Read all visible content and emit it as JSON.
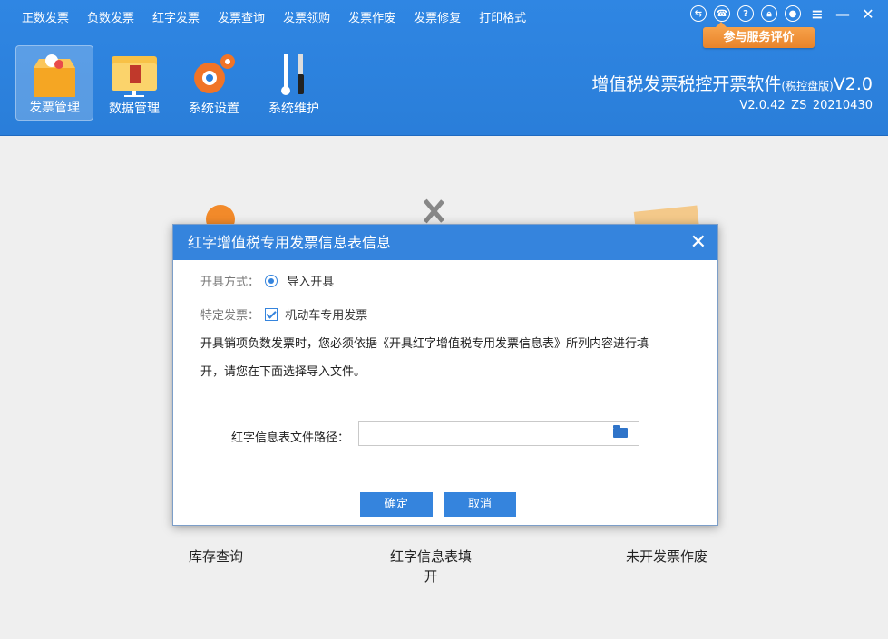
{
  "menu": [
    "正数发票",
    "负数发票",
    "红字发票",
    "发票查询",
    "发票领购",
    "发票作废",
    "发票修复",
    "打印格式"
  ],
  "top_icons": [
    "exchange-icon",
    "phone-icon",
    "help-icon",
    "lock-icon",
    "user-icon",
    "menu-icon",
    "minimize-icon",
    "close-icon"
  ],
  "feedback_label": "参与服务评价",
  "toolbar": [
    {
      "label": "发票管理",
      "active": true
    },
    {
      "label": "数据管理",
      "active": false
    },
    {
      "label": "系统设置",
      "active": false
    },
    {
      "label": "系统维护",
      "active": false
    }
  ],
  "brand": {
    "title": "增值税发票税控开票软件",
    "edition": "(税控盘版)",
    "suffix": "V2.0",
    "version": "V2.0.42_ZS_20210430"
  },
  "cards": [
    "库存查询",
    "红字信息表填开",
    "未开发票作废"
  ],
  "dialog": {
    "title": "红字增值税专用发票信息表信息",
    "method_label": "开具方式：",
    "method_value": "导入开具",
    "special_label": "特定发票：",
    "special_value": "机动车专用发票",
    "description_line1": "开具销项负数发票时，您必须依据《开具红字增值税专用发票信息表》所列内容进行填",
    "description_line2": "开，请您在下面选择导入文件。",
    "path_label": "红字信息表文件路径：",
    "path_value": "",
    "ok": "确定",
    "cancel": "取消"
  },
  "colors": {
    "header": "#2f86e3",
    "accent": "#3584dd",
    "badge": "#f39a3e"
  }
}
